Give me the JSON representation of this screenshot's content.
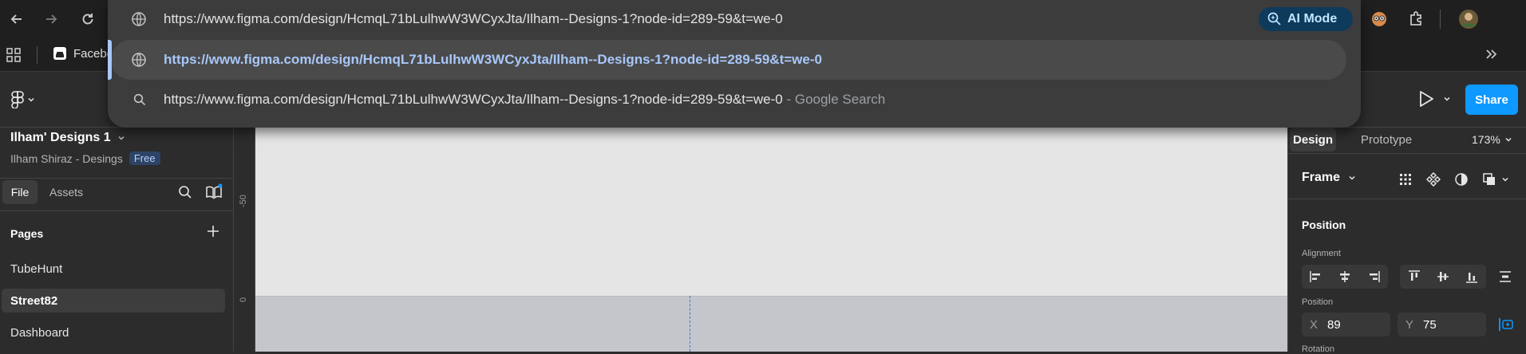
{
  "browser": {
    "address_text": "https://www.figma.com/design/HcmqL71bLulhwW3WCyxJta/Ilham--Designs-1?node-id=289-59&t=we-0",
    "ai_mode_label": "AI Mode",
    "bookmark_label": "Facebo",
    "suggestions": [
      {
        "icon": "globe-icon",
        "text": "https://www.figma.com/design/HcmqL71bLulhwW3WCyxJta/Ilham--Designs-1?node-id=289-59&t=we-0",
        "suffix": ""
      },
      {
        "icon": "search-icon",
        "text": "https://www.figma.com/design/HcmqL71bLulhwW3WCyxJta/Ilham--Designs-1?node-id=289-59&t=we-0",
        "suffix": " - Google Search"
      }
    ]
  },
  "figma": {
    "share_label": "Share",
    "file_title": "Ilham' Designs 1",
    "team_name": "Ilham Shiraz - Desings",
    "plan_badge": "Free",
    "tabs": {
      "file": "File",
      "assets": "Assets"
    },
    "pages_heading": "Pages",
    "pages": [
      "TubeHunt",
      "Street82",
      "Dashboard"
    ],
    "selected_page": "Street82",
    "ruler_labels": {
      "minus50": "-50",
      "zero": "0"
    },
    "right": {
      "tabs": {
        "design": "Design",
        "prototype": "Prototype"
      },
      "zoom": "173%",
      "frame_label": "Frame",
      "position_heading": "Position",
      "alignment_label": "Alignment",
      "position_label": "Position",
      "x_label": "X",
      "x_value": "89",
      "y_label": "Y",
      "y_value": "75",
      "rotation_label": "Rotation"
    }
  },
  "colors": {
    "accent": "#0d99ff",
    "ai_mode_bg": "#0e3a5c",
    "selected_url": "#a8c7fa",
    "canvas": "#e5e5e5",
    "frame": "#c5c6cb"
  }
}
